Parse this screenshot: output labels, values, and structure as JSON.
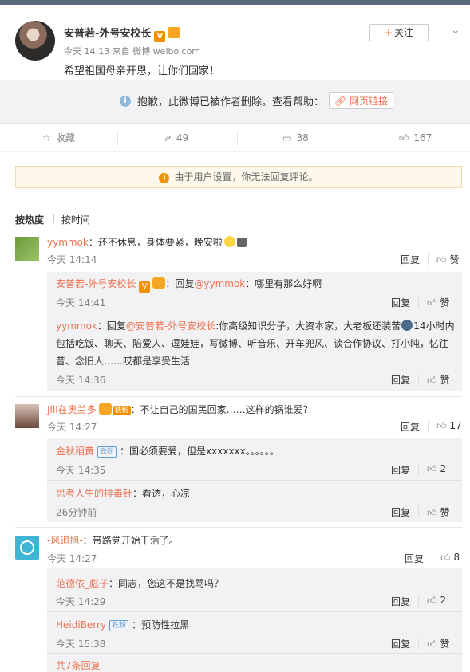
{
  "post": {
    "author": "安普若-外号安校长",
    "meta": "今天 14:13 来自 微博 weibo.com",
    "text": "希望祖国母亲开恩，让你们回家！",
    "follow_label": "关注",
    "v_badge": "V"
  },
  "deleted": {
    "message": "抱歉，此微博已被作者删除。查看帮助：",
    "link_label": "网页链接",
    "info_icon": "i"
  },
  "actions": {
    "favorite_label": "收藏",
    "repost_count": "49",
    "comment_count": "38",
    "like_count": "167"
  },
  "notice": {
    "text": "由于用户设置，你无法回复评论。",
    "icon": "!"
  },
  "sort": {
    "hot": "按热度",
    "time": "按时间"
  },
  "labels": {
    "reply": "回复",
    "like": "赞",
    "tiefen": "铁粉",
    "colon": "：",
    "reply_prefix": "回复",
    "at": "@"
  },
  "comments": [
    {
      "user": "yymmok",
      "text": "还不休息，身体要紧，晚安啦",
      "time": "今天 14:14",
      "like": "赞",
      "replies": [
        {
          "user": "安普若-外号安校长",
          "reply_to": "yymmok",
          "text": "哪里有那么好啊",
          "time": "今天 14:41",
          "like": "赞"
        },
        {
          "user": "yymmok",
          "reply_to": "安普若-外号安校长",
          "text_line1": ":你高级知识分子，大资本家，大老板还装苦",
          "text_line1b": "14小时内",
          "text_line2": "包括吃饭、聊天、陪爱人、逗娃娃，写微博、听音乐、开车兜风、谈合作协议、打小盹，忆往",
          "text_line3": "昔、念旧人……哎都是享受生活",
          "time": "今天 14:36",
          "like": "赞"
        }
      ]
    },
    {
      "user": "Jill在奥兰多",
      "text": "不让自己的国民回家……这样的锅谁爱？",
      "time": "今天 14:27",
      "like": "17",
      "replies": [
        {
          "user": "金秋稻黄",
          "text": "国必须要爱，但是xxxxxxx。。。。。。",
          "time": "今天 14:35",
          "like": "2"
        },
        {
          "user": "思考人生的排毒针",
          "text": "看透，心凉",
          "time": "26分钟前",
          "like": "赞"
        }
      ]
    },
    {
      "user": "-风追旭-",
      "text": "带路党开始干活了。",
      "time": "今天 14:27",
      "like": "8",
      "replies": [
        {
          "user": "范德依_彪子",
          "text": "同志，您这不是找骂吗？",
          "time": "今天 14:29",
          "like": "2"
        },
        {
          "user": "HeidiBerry",
          "text": "预防性拉黑",
          "time": "今天 15:38",
          "like": "赞"
        }
      ]
    }
  ],
  "more_replies": "共7条回复"
}
